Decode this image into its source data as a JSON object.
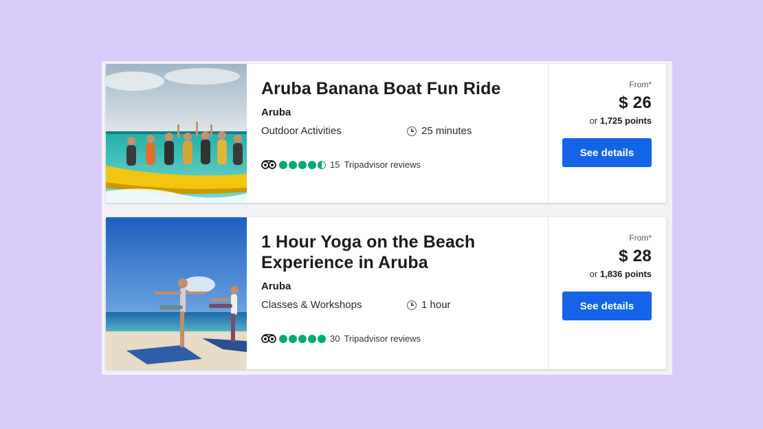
{
  "listings": [
    {
      "title": "Aruba Banana Boat Fun Ride",
      "location": "Aruba",
      "category": "Outdoor Activities",
      "duration": "25 minutes",
      "rating": 4.5,
      "review_count": "15",
      "review_label": "Tripadvisor reviews",
      "from_label": "From*",
      "price": "$ 26",
      "points_prefix": "or",
      "points": "1,725 points",
      "button_label": "See details",
      "image": "banana-boat-photo"
    },
    {
      "title": "1 Hour Yoga on the Beach Experience in Aruba",
      "location": "Aruba",
      "category": "Classes & Workshops",
      "duration": "1 hour",
      "rating": 5,
      "review_count": "30",
      "review_label": "Tripadvisor reviews",
      "from_label": "From*",
      "price": "$ 28",
      "points_prefix": "or",
      "points": "1,836 points",
      "button_label": "See details",
      "image": "beach-yoga-photo"
    }
  ],
  "colors": {
    "background": "#d9ccfb",
    "button": "#1564e8",
    "rating_green": "#00aa6c"
  },
  "icons": [
    "clock-icon",
    "tripadvisor-owl-icon",
    "rating-bubble-icon"
  ]
}
